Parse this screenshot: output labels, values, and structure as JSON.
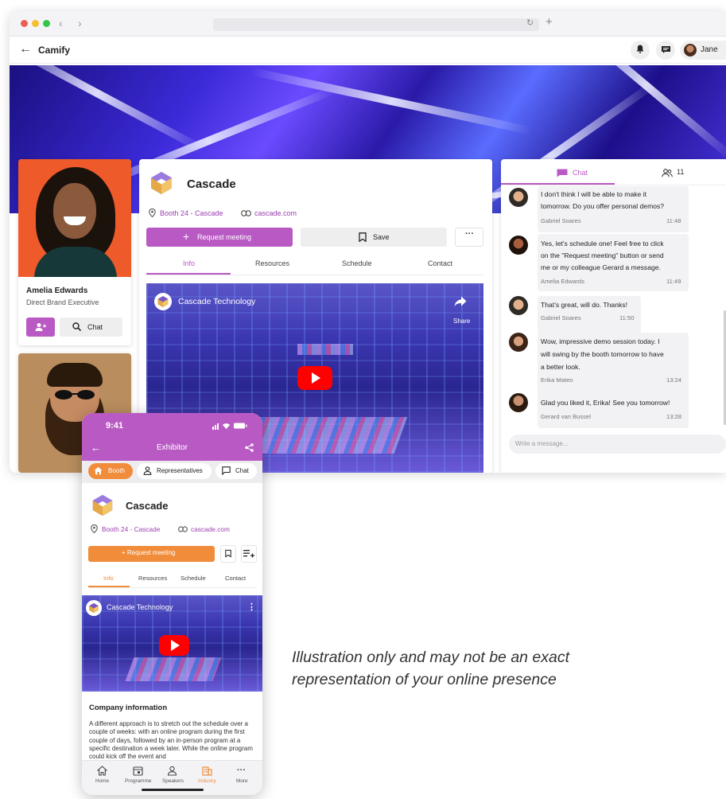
{
  "browser": {
    "app_title": "Camify",
    "user_name": "Jane"
  },
  "representatives": [
    {
      "name": "Amelia Edwards",
      "role": "Direct Brand Executive",
      "chat_label": "Chat"
    }
  ],
  "booth": {
    "company": "Cascade",
    "booth": "Booth 24 - Cascade",
    "website": "cascade.com",
    "request_label": "Request meeting",
    "save_label": "Save",
    "more_label": "···",
    "tabs": [
      "Info",
      "Resources",
      "Schedule",
      "Contact"
    ],
    "active_tab": "Info",
    "video_title": "Cascade Technology",
    "share_label": "Share"
  },
  "chat": {
    "tab_label": "Chat",
    "participants": "11",
    "input_placeholder": "Write a message...",
    "messages": [
      {
        "lines": [
          "I don't think I will be able to make it",
          "tomorrow. Do you offer personal demos?"
        ],
        "author": "Gabriel Soares",
        "time": "11:48"
      },
      {
        "lines": [
          "Yes,  let's schedule one! Feel free to click",
          "on the \"Request meeting\" button or send",
          "me or my colleague Gerard a message."
        ],
        "author": "Amelia Edwards",
        "time": "11:49"
      },
      {
        "lines": [
          "That's great, will do. Thanks!"
        ],
        "author": "Gabriel Soares",
        "time": "11:50"
      },
      {
        "lines": [
          "Wow, impressive demo session today. I",
          "will swing by the booth tomorrow to have",
          "a better look."
        ],
        "author": "Erika Mateo",
        "time": "13:24"
      },
      {
        "lines": [
          "Glad you liked it, Erika! See you tomorrow!"
        ],
        "author": "Gerard van Bussel",
        "time": "13:28"
      }
    ]
  },
  "phone": {
    "time": "9:41",
    "title": "Exhibitor",
    "chips": [
      "Booth",
      "Representatives",
      "Chat"
    ],
    "company": "Cascade",
    "booth": "Booth 24 - Cascade",
    "website": "cascade.com",
    "request_label": "+ Request meeting",
    "tabs": [
      "Info",
      "Resources",
      "Schedule",
      "Contact"
    ],
    "video_title": "Cascade Technology",
    "section_title": "Company information",
    "description": "A different approach is to stretch out the schedule over a couple of weeks: with an online program during the first couple of days, followed by an in-person program at a specific destination a week later. While the online program could kick off the event and",
    "nav": [
      "Home",
      "Programme",
      "Speakers",
      "Industry",
      "More"
    ],
    "active_nav": "Industry"
  },
  "caption": {
    "line1": "Illustration only and may not be an exact",
    "line2": "representation of your online presence"
  },
  "colors": {
    "desktop_accent": "#b95ac4",
    "phone_accent": "#f08c3a"
  }
}
